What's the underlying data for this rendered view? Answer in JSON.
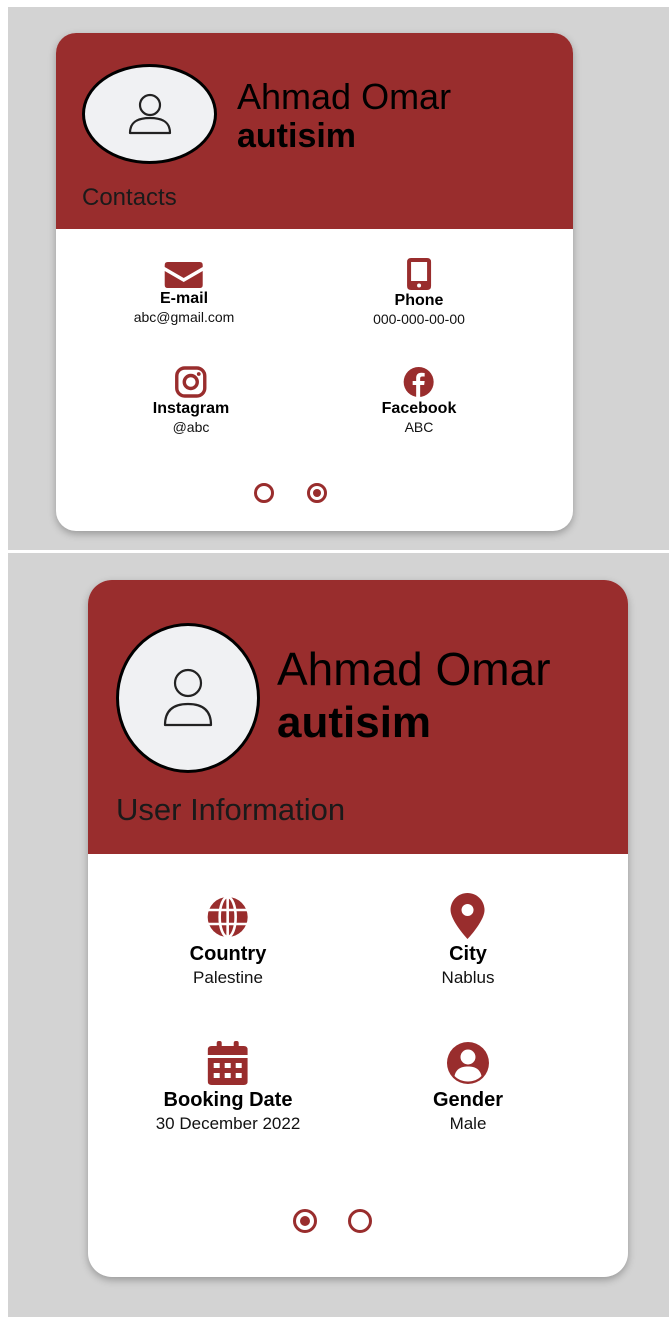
{
  "colors": {
    "accent": "#992d2d",
    "panel_bg": "#d3d3d3",
    "avatar_bg": "#f0f1f3"
  },
  "contacts_card": {
    "name": "Ahmad Omar",
    "condition": "autisim",
    "section_title": "Contacts",
    "items": [
      {
        "icon": "envelope-icon",
        "label": "E-mail",
        "value": "abc@gmail.com"
      },
      {
        "icon": "phone-icon",
        "label": "Phone",
        "value": "000-000-00-00"
      },
      {
        "icon": "instagram-icon",
        "label": "Instagram",
        "value": "@abc"
      },
      {
        "icon": "facebook-icon",
        "label": "Facebook",
        "value": "ABC"
      }
    ],
    "pagination": {
      "total": 2,
      "active": 2
    }
  },
  "user_info_card": {
    "name": "Ahmad Omar",
    "condition": "autisim",
    "section_title": "User Information",
    "items": [
      {
        "icon": "globe-icon",
        "label": "Country",
        "value": "Palestine"
      },
      {
        "icon": "location-pin-icon",
        "label": "City",
        "value": "Nablus"
      },
      {
        "icon": "calendar-icon",
        "label": "Booking Date",
        "value": "30 December 2022"
      },
      {
        "icon": "user-circle-icon",
        "label": "Gender",
        "value": "Male"
      }
    ],
    "pagination": {
      "total": 2,
      "active": 1
    }
  }
}
